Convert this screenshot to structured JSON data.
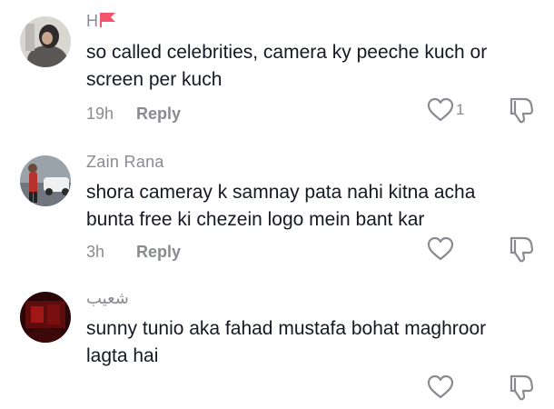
{
  "comments": [
    {
      "username": "H",
      "badge_icon": "red-flag-icon",
      "text": "so called celebrities, camera ky peeche kuch or screen per kuch",
      "time": "19h",
      "reply_label": "Reply",
      "like_count": "1"
    },
    {
      "username": "Zain Rana",
      "text": "shora cameray k samnay pata nahi kitna acha bunta free ki chezein logo mein bant kar",
      "time": "3h",
      "reply_label": "Reply",
      "like_count": ""
    },
    {
      "username": "شعیب",
      "text": "sunny tunio aka fahad mustafa bohat maghroor lagta hai",
      "time": "",
      "reply_label": "",
      "like_count": ""
    }
  ],
  "colors": {
    "primary_text": "#161823",
    "secondary_text": "#8a8b91",
    "flag": "#f2556b"
  }
}
